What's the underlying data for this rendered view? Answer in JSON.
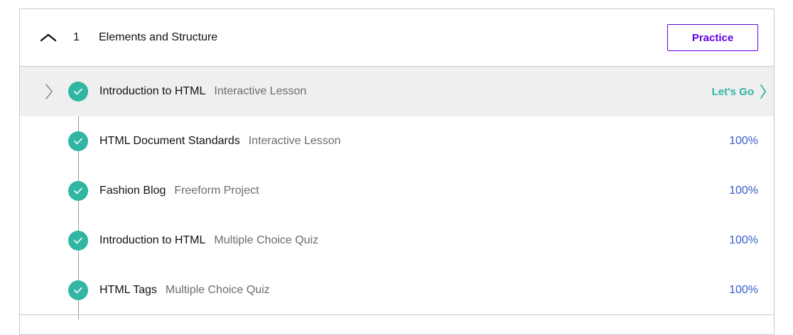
{
  "module": {
    "number": "1",
    "title": "Elements and Structure",
    "practice_label": "Practice"
  },
  "lessons": [
    {
      "name": "Introduction to HTML",
      "type": "Interactive Lesson",
      "status": "Let's Go"
    },
    {
      "name": "HTML Document Standards",
      "type": "Interactive Lesson",
      "status": "100%"
    },
    {
      "name": "Fashion Blog",
      "type": "Freeform Project",
      "status": "100%"
    },
    {
      "name": "Introduction to HTML",
      "type": "Multiple Choice Quiz",
      "status": "100%"
    },
    {
      "name": "HTML Tags",
      "type": "Multiple Choice Quiz",
      "status": "100%"
    }
  ],
  "colors": {
    "accent_purple": "#6400e4",
    "complete_teal": "#30b6a2",
    "progress_blue": "#3a5ccc",
    "active_row_bg": "#efeff0"
  },
  "icons": {
    "collapse": "chevron-up-icon",
    "row_expand": "chevron-right-icon",
    "complete": "checkmark-icon",
    "go": "chevron-right-icon"
  }
}
